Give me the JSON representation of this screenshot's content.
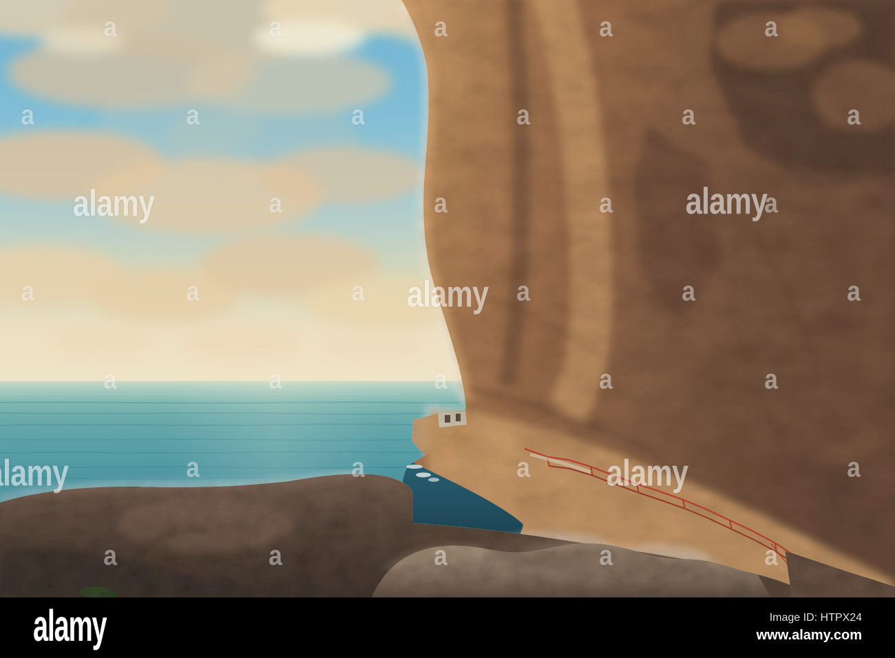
{
  "footer": {
    "logo": "alamy",
    "image_id": "Image ID: HTPX24",
    "website": "www.alamy.com"
  },
  "watermark": {
    "brand": "alamy",
    "mark": "a"
  },
  "colors": {
    "footer-bg": "#000000",
    "footer-text": "#ffffff",
    "footer-subtext": "#e0e0e0",
    "watermark-color": "#ffffff",
    "sky-blue": "#6fb6d6",
    "cloud-cream": "#e9d4ae",
    "sea-teal": "#4e9aa6",
    "cove-teal": "#15455a",
    "cliff-brown": "#8a5f43",
    "cliff-highlight": "#d8ab76",
    "rock-dark": "#4e3e35",
    "rock-grey": "#8d7b6a",
    "railing-red": "#a33a28"
  }
}
